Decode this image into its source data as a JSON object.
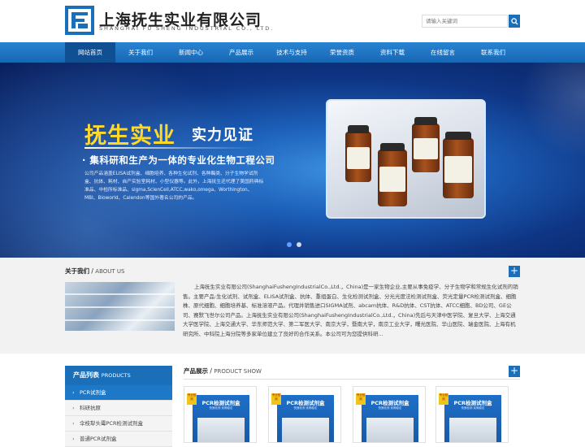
{
  "header": {
    "company_cn": "上海抚生实业有限公司",
    "company_en": "SHANGHAI FU SHENG INDUSTRIAL CO., LTD.",
    "search_placeholder": "请输入关键词"
  },
  "nav": {
    "items": [
      "网站首页",
      "关于我们",
      "新闻中心",
      "产品展示",
      "技术与支持",
      "荣誉资质",
      "资料下载",
      "在线留言",
      "联系我们"
    ]
  },
  "banner": {
    "headline": "抚生实业",
    "headline_suffix": "实力见证",
    "subline": "· 集科研和生产为一体的专业化生物工程公司",
    "body": "公司产品涵盖ELISA试剂盒、细胞培养、各种生化试剂、各种酶类、分子生物学试剂盒、抗体、耗材、自产实验室耗材、小型仪器等。此外，上海抚生还代理了美国药典标准品、中检所标准品、sigma,ScienCell,ATCC,wako,omega、Worthington、MBI、Bioworld、Calendon等国外著名公司的产品。",
    "vial_labels": [
      "USP",
      "USP",
      "USP",
      "USP"
    ]
  },
  "about": {
    "title_cn": "关于我们",
    "title_en": "ABOUT US",
    "text": "上海抚生实业有限公司(ShanghaiFushengIndustrialCo.,Ltd.，China)是一家生物企业,主要从事免疫学、分子生物学和常规生化试剂的销售。主要产品:生化试剂、试剂盒、ELISA试剂盒、抗体、重组蛋白、生化检测试剂盒、分光光度法检测试剂盒、荧光定量PCR检测试剂盒、细胞株、原代细胞、细胞培养基、标准溶液产品。代理并销售进口SIGMA试剂、abcam抗体、R&D抗体、CST抗体、ATCC细胞、BD公司、GE公司、赛默飞世尔公司产品。上海抚生实业有限公司(ShanghaiFushengIndustrialCo.,Ltd.，China)先后与天津中医学院、复旦大学、上海交通大学医学院、上海交通大学、华东师范大学、第二军医大学、南京大学，暨南大学，南京工业大学，曙光医院、华山医院、瑞金医院、上海有机研究所、中科院上海分院等多家单位建立了良好的合作关系。本公司可为您提供科研..."
  },
  "products": {
    "sidebar_title_cn": "产品列表",
    "sidebar_title_en": "PRODUCTS",
    "categories": [
      "PCR试剂盒",
      "科研抗原",
      "伞枝犁头霉PCR检测试剂盒",
      "普通PCR试剂盒"
    ],
    "title_cn": "产品展示",
    "title_en": "PRODUCT SHOW",
    "items": [
      {
        "box_title": "PCR检测试剂盒",
        "tag": "专业检测"
      },
      {
        "box_title": "PCR检测试剂盒",
        "tag": "专业检测"
      },
      {
        "box_title": "PCR检测试剂盒",
        "tag": "专业检测"
      },
      {
        "box_title": "PCR检测试剂盒",
        "tag": "专业检测"
      }
    ],
    "box_subtitle": "快速检测 准确稳定"
  },
  "colors": {
    "primary": "#1a6fb8",
    "nav_active": "#0f4f92",
    "headline": "#ffd92a"
  }
}
